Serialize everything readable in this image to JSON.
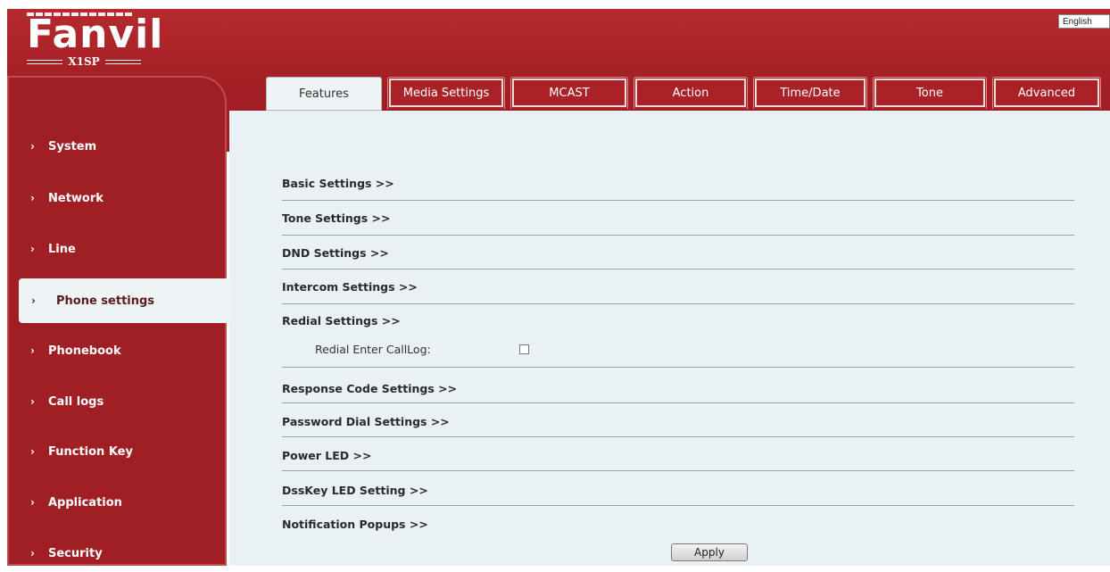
{
  "brand": {
    "logo_text": "Fanvil",
    "model": "X1SP"
  },
  "language": {
    "selected": "English"
  },
  "tabs": [
    {
      "label": "Features",
      "active": true
    },
    {
      "label": "Media Settings"
    },
    {
      "label": "MCAST"
    },
    {
      "label": "Action"
    },
    {
      "label": "Time/Date"
    },
    {
      "label": "Tone"
    },
    {
      "label": "Advanced"
    }
  ],
  "sidebar": {
    "chevron": "›",
    "items": [
      {
        "label": "System"
      },
      {
        "label": "Network"
      },
      {
        "label": "Line"
      },
      {
        "label": "Phone settings",
        "active": true
      },
      {
        "label": "Phonebook"
      },
      {
        "label": "Call logs"
      },
      {
        "label": "Function Key"
      },
      {
        "label": "Application"
      },
      {
        "label": "Security"
      }
    ]
  },
  "sections": [
    {
      "title": "Basic Settings >>"
    },
    {
      "title": "Tone Settings >>"
    },
    {
      "title": "DND Settings >>"
    },
    {
      "title": "Intercom Settings >>"
    },
    {
      "title": "Redial Settings >>"
    },
    {
      "title": "Response Code Settings >>"
    },
    {
      "title": "Password Dial Settings >>"
    },
    {
      "title": "Power LED >>"
    },
    {
      "title": "DssKey LED Setting >>"
    },
    {
      "title": "Notification Popups >>"
    }
  ],
  "redial": {
    "enter_calllog_label": "Redial Enter CallLog:",
    "enter_calllog_checked": false
  },
  "buttons": {
    "apply": "Apply"
  },
  "colors": {
    "brand_red": "#a01f24",
    "content_bg": "#e9f1f4",
    "active_tab_bg": "#eef3f6"
  }
}
